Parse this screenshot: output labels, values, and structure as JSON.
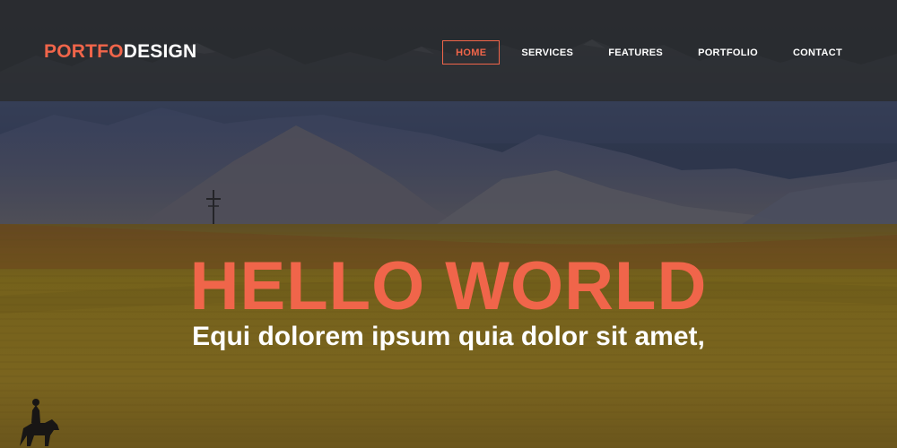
{
  "brand": {
    "accent_text": "PORTFO",
    "rest_text": "DESIGN",
    "accent_color": "#f0654a"
  },
  "nav": {
    "items": [
      {
        "label": "HOME",
        "active": true
      },
      {
        "label": "SERVICES",
        "active": false
      },
      {
        "label": "FEATURES",
        "active": false
      },
      {
        "label": "PORTFOLIO",
        "active": false
      },
      {
        "label": "CONTACT",
        "active": false
      }
    ]
  },
  "hero": {
    "title": "HELLO WORLD",
    "subtitle": "Equi dolorem ipsum quia dolor sit amet,",
    "background": "mountains-and-wheat-field-photo"
  }
}
